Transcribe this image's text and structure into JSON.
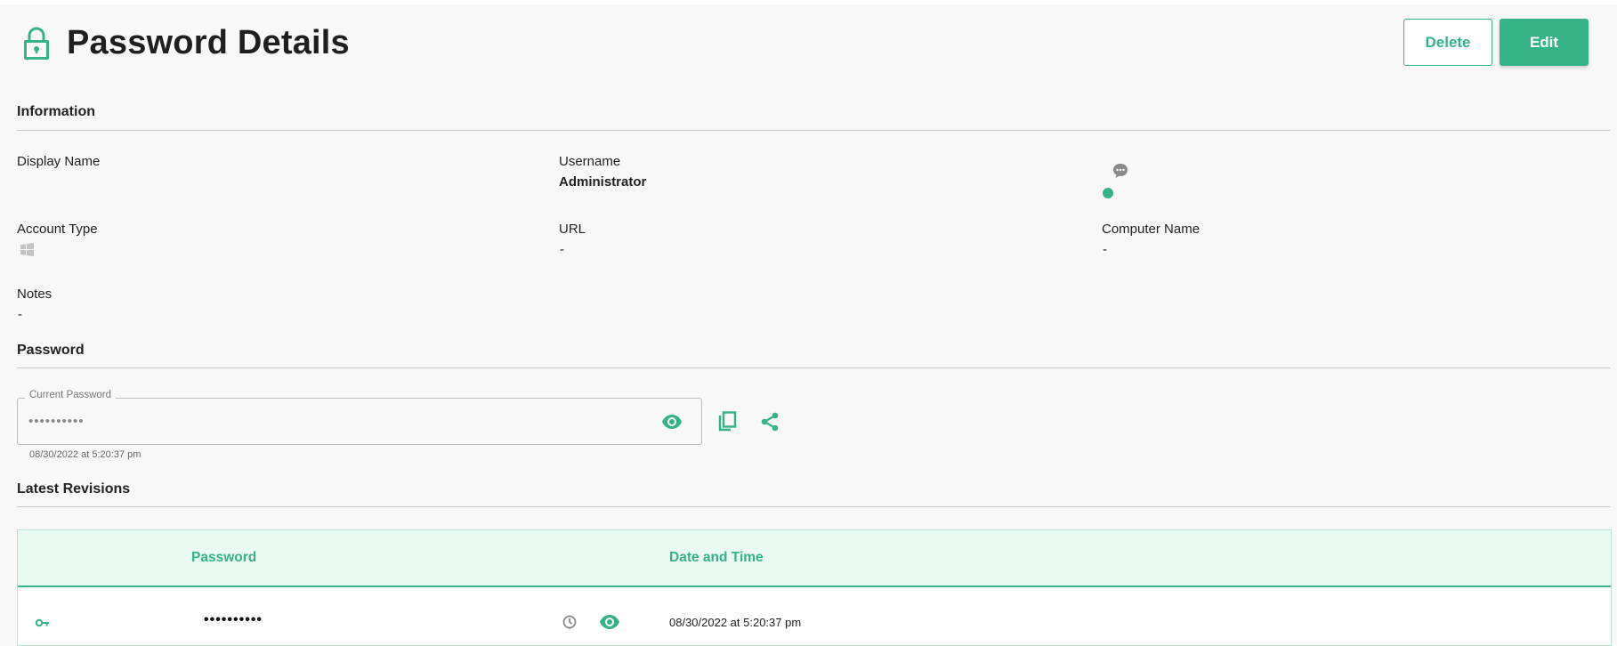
{
  "header": {
    "title": "Password Details",
    "delete_label": "Delete",
    "edit_label": "Edit"
  },
  "information": {
    "section_title": "Information",
    "display_name_label": "Display Name",
    "username_label": "Username",
    "username_value": "Administrator",
    "account_type_label": "Account Type",
    "account_type_icon": "windows-icon",
    "url_label": "URL",
    "url_value": "-",
    "computer_name_label": "Computer Name",
    "computer_name_value": "-",
    "notes_label": "Notes",
    "notes_value": "-",
    "status_icon": "chat-bubble-icon",
    "status_dot_color": "#35b386"
  },
  "password": {
    "section_title": "Password",
    "field_label": "Current Password",
    "masked_value": "••••••••••",
    "timestamp": "08/30/2022 at 5:20:37 pm",
    "icons": [
      "eye-icon",
      "copy-icon",
      "share-icon"
    ]
  },
  "revisions": {
    "section_title": "Latest Revisions",
    "columns": [
      "Password",
      "Date and Time"
    ],
    "rows": [
      {
        "icon": "key-icon",
        "password": "••••••••••",
        "date_time": "08/30/2022 at 5:20:37 pm",
        "actions": [
          "restore-icon",
          "eye-icon"
        ]
      }
    ]
  },
  "colors": {
    "accent": "#35b386",
    "background": "#f8f8f8",
    "table_header_bg": "#ebf9f3"
  }
}
